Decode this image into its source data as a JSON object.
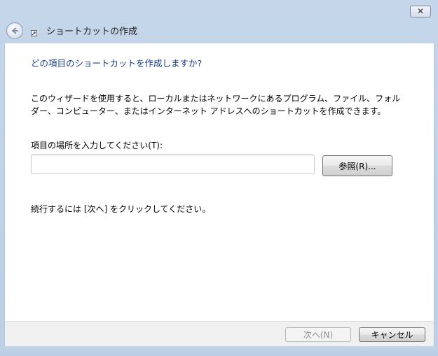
{
  "window": {
    "close_label": "✕",
    "title": "ショートカットの作成"
  },
  "icons": {
    "back": "back-arrow-icon",
    "shortcut": "shortcut-arrow-icon",
    "close": "close-icon"
  },
  "main": {
    "question": "どの項目のショートカットを作成しますか?",
    "description_line1": "このウィザードを使用すると、ローカルまたはネットワークにあるプログラム、ファイル、フォル",
    "description_line2": "ダー、コンピューター、またはインターネット アドレスへのショートカットを作成できます。",
    "location_label": "項目の場所を入力してください(T):",
    "location_value": "",
    "location_placeholder": "",
    "browse_label": "参照(R)...",
    "hint": "続行するには [次へ] をクリックしてください。"
  },
  "footer": {
    "next_label": "次へ(N)",
    "cancel_label": "キャンセル"
  },
  "colors": {
    "question_text": "#1a3d8c",
    "frame": "#c5d6ea",
    "footer_bg": "#f0f0f0"
  }
}
